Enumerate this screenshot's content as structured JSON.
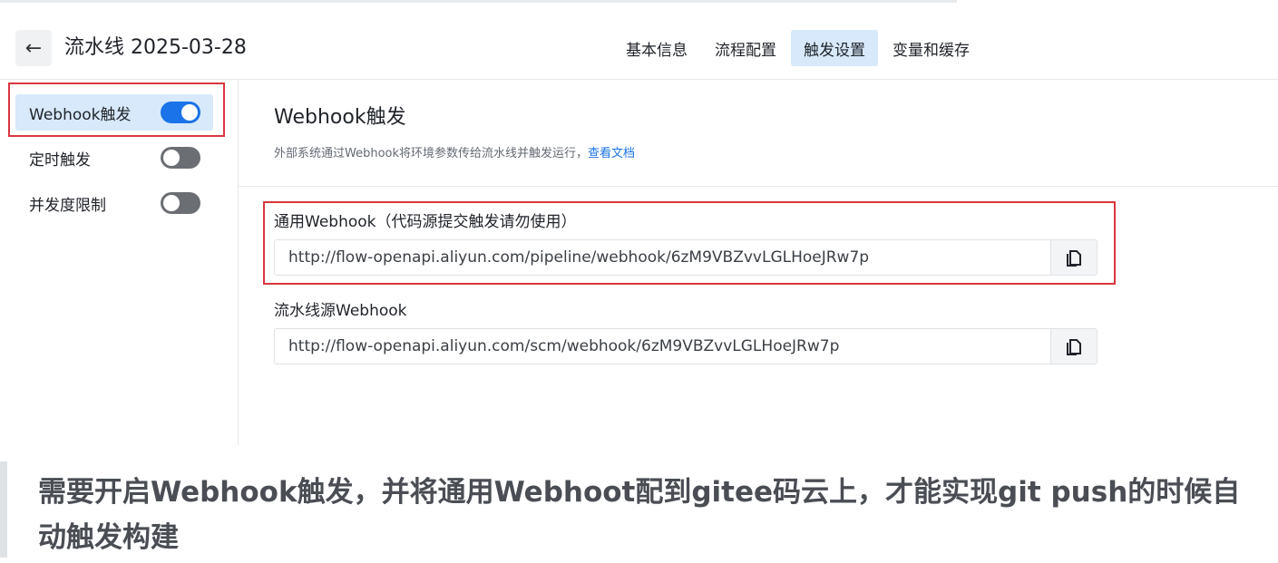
{
  "header": {
    "back_icon": "←",
    "title": "流水线 2025-03-28",
    "tabs": [
      {
        "label": "基本信息",
        "active": false
      },
      {
        "label": "流程配置",
        "active": false
      },
      {
        "label": "触发设置",
        "active": true
      },
      {
        "label": "变量和缓存",
        "active": false
      }
    ]
  },
  "sidebar": {
    "items": [
      {
        "label": "Webhook触发",
        "toggle_on": true,
        "active": true
      },
      {
        "label": "定时触发",
        "toggle_on": false,
        "active": false
      },
      {
        "label": "并发度限制",
        "toggle_on": false,
        "active": false
      }
    ]
  },
  "content": {
    "title": "Webhook触发",
    "description": "外部系统通过Webhook将环境参数传给流水线并触发运行，",
    "doc_link": "查看文档",
    "fields": [
      {
        "label": "通用Webhook（代码源提交触发请勿使用）",
        "url": "http://flow-openapi.aliyun.com/pipeline/webhook/6zM9VBZvvLGLHoeJRw7p",
        "copy_icon": "copy-icon"
      },
      {
        "label": "流水线源Webhook",
        "url": "http://flow-openapi.aliyun.com/scm/webhook/6zM9VBZvvLGLHoeJRw7p",
        "copy_icon": "copy-icon"
      }
    ]
  },
  "colors": {
    "accent": "#1a73e8",
    "highlight": "#d9363e",
    "active_bg": "#d7e9fb"
  },
  "note": "需要开启Webhook触发，并将通用Webhoot配到gitee码云上，才能实现git push的时候自动触发构建"
}
